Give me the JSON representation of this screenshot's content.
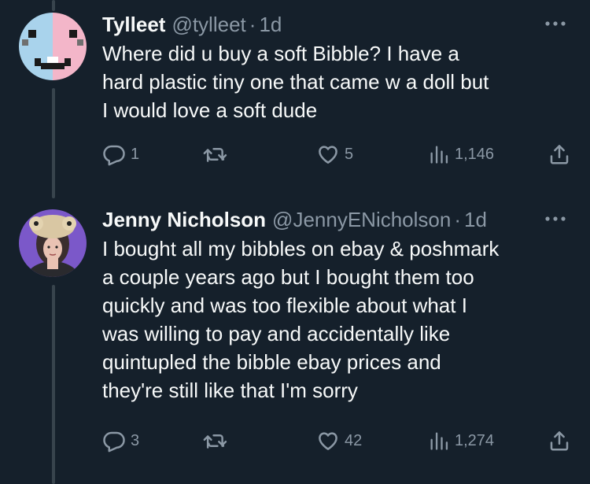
{
  "tweets": [
    {
      "name": "Tylleet",
      "handle": "@tylleet",
      "separator": "·",
      "time": "1d",
      "text": "Where did u buy a soft Bibble? I have a\nhard plastic tiny one that came w a doll but\nI would love a soft dude",
      "replies": "1",
      "retweets": "",
      "likes": "5",
      "views": "1,146"
    },
    {
      "name": "Jenny Nicholson",
      "handle": "@JennyENicholson",
      "separator": "·",
      "time": "1d",
      "text": "I bought all my bibbles on ebay & poshmark\na couple years ago but I bought them too\nquickly and was too flexible about what I\nwas willing to pay and accidentally like\nquintupled the bibble ebay prices and\nthey're still like that I'm sorry",
      "replies": "3",
      "retweets": "",
      "likes": "42",
      "views": "1,274"
    }
  ],
  "icons": {
    "reply": "reply-icon",
    "retweet": "retweet-icon",
    "like": "heart-icon",
    "views": "views-icon",
    "share": "share-icon",
    "more": "more-icon"
  },
  "colors": {
    "background": "#15202b",
    "text": "#f7f9f9",
    "muted": "#8b98a5",
    "thread_line": "#38444d"
  }
}
